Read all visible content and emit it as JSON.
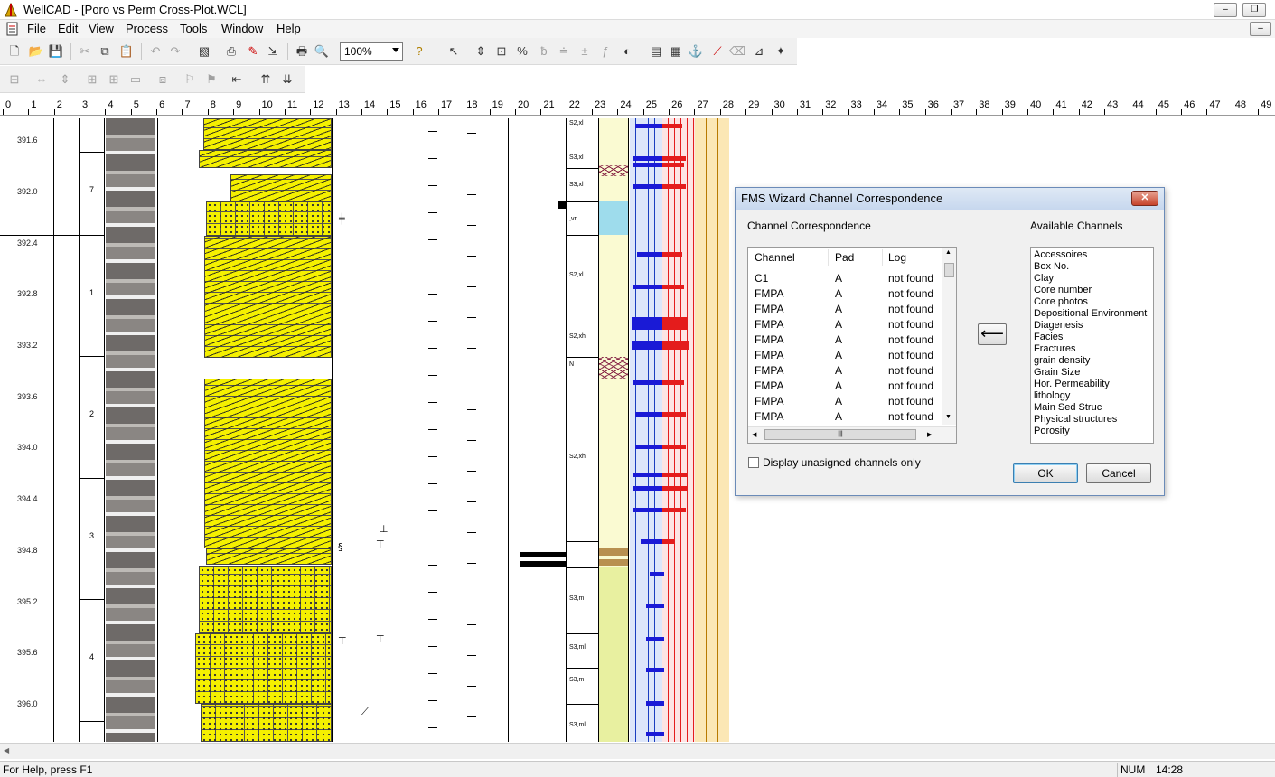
{
  "window": {
    "app_name": "WellCAD",
    "title": "WellCAD - [Poro vs Perm Cross-Plot.WCL]",
    "minimize_glyph": "‒",
    "restore_glyph": "❐",
    "inner_minimize_glyph": "‒"
  },
  "menu": [
    "File",
    "Edit",
    "View",
    "Process",
    "Tools",
    "Window",
    "Help"
  ],
  "toolbar": {
    "zoom_value": "100%",
    "icons_row1": [
      "new-file-icon",
      "open-folder-icon",
      "save-icon",
      "cut-icon",
      "copy-icon",
      "paste-icon",
      "undo-icon",
      "redo-icon",
      "hatch-icon",
      "print-preview-icon",
      "color-pick-icon",
      "import-icon",
      "print-icon",
      "preview-icon",
      "help-icon",
      "select-pointer-icon",
      "move-icon",
      "resize-icon",
      "percent-icon",
      "tool-a-icon",
      "tool-b-icon",
      "tool-c-icon",
      "tool-d-icon",
      "formula-icon",
      "palette-icon",
      "document-icon",
      "table-icon",
      "anchor-icon",
      "edit-line-icon",
      "eraser-icon",
      "shape-icon",
      "wand-icon"
    ],
    "icons_row2": [
      "align-left-icon",
      "width-icon",
      "height-icon",
      "distribute-h-icon",
      "distribute-v-icon",
      "group-icon",
      "link-icon",
      "flag-a-icon",
      "flag-b-icon",
      "insert-icon",
      "sort-asc-icon",
      "sort-desc-icon"
    ]
  },
  "ruler": {
    "labels": [
      "0",
      "1",
      "2",
      "3",
      "4",
      "5",
      "6",
      "7",
      "8",
      "9",
      "10",
      "11",
      "12",
      "13",
      "14",
      "15",
      "16",
      "17",
      "18",
      "19",
      "20",
      "21",
      "22",
      "23",
      "24",
      "25",
      "26",
      "27",
      "28",
      "29",
      "30",
      "31",
      "32",
      "33",
      "34",
      "35",
      "36",
      "37",
      "38",
      "39",
      "40",
      "41",
      "42",
      "43",
      "44",
      "45",
      "46",
      "47",
      "48",
      "49"
    ]
  },
  "depth_log": {
    "labels": [
      "391.6",
      "392.0",
      "392.4",
      "392.8",
      "393.2",
      "393.6",
      "394.0",
      "394.4",
      "394.8",
      "395.2",
      "395.6",
      "396.0"
    ],
    "core_numbers": [
      "7",
      "1",
      "2",
      "3",
      "4"
    ],
    "facies_labels": [
      "S2,xl",
      "S3,xl",
      "S3,xl",
      ",vr",
      "S2,xl",
      "S2,xh",
      "N",
      "S2,xh",
      "S3,m",
      "S3,ml",
      "S3,m",
      "S3,ml"
    ]
  },
  "dialog": {
    "title": "FMS Wizard Channel Correspondence",
    "close_glyph": "✕",
    "left_heading": "Channel Correspondence",
    "right_heading": "Available Channels",
    "columns": [
      "Channel",
      "Pad",
      "Log"
    ],
    "rows": [
      {
        "channel": "C1",
        "pad": "A",
        "log": "not found"
      },
      {
        "channel": "FMPA",
        "pad": "A",
        "log": "not found"
      },
      {
        "channel": "FMPA",
        "pad": "A",
        "log": "not found"
      },
      {
        "channel": "FMPA",
        "pad": "A",
        "log": "not found"
      },
      {
        "channel": "FMPA",
        "pad": "A",
        "log": "not found"
      },
      {
        "channel": "FMPA",
        "pad": "A",
        "log": "not found"
      },
      {
        "channel": "FMPA",
        "pad": "A",
        "log": "not found"
      },
      {
        "channel": "FMPA",
        "pad": "A",
        "log": "not found"
      },
      {
        "channel": "FMPA",
        "pad": "A",
        "log": "not found"
      },
      {
        "channel": "FMPA",
        "pad": "A",
        "log": "not found"
      }
    ],
    "available": [
      "Accessoires",
      "Box No.",
      "Clay",
      "Core number",
      "Core photos",
      "Depositional Environment",
      "Diagenesis",
      "Facies",
      "Fractures",
      "grain density",
      "Grain Size",
      "Hor. Permeability",
      "lithology",
      "Main Sed Struc",
      "Physical structures",
      "Porosity"
    ],
    "assign_glyph": "⟵",
    "checkbox_label": "Display unasigned channels only",
    "ok_label": "OK",
    "cancel_label": "Cancel",
    "scroll_up_glyph": "▲",
    "scroll_down_glyph": "▼",
    "scroll_left_glyph": "◀",
    "scroll_right_glyph": "▶",
    "scroll_grip_glyph": "|||"
  },
  "statusbar": {
    "help_text": "For Help, press F1",
    "num": "NUM",
    "time": "14:28"
  },
  "main_scroll": {
    "left_glyph": "◀"
  },
  "colors": {
    "lithology_yellow": "#f5f000",
    "facies_blue": "#1a1ad6",
    "facies_red": "#e41c1c",
    "facies_cyan": "#9edcec",
    "facies_pale": "#fafad2"
  }
}
